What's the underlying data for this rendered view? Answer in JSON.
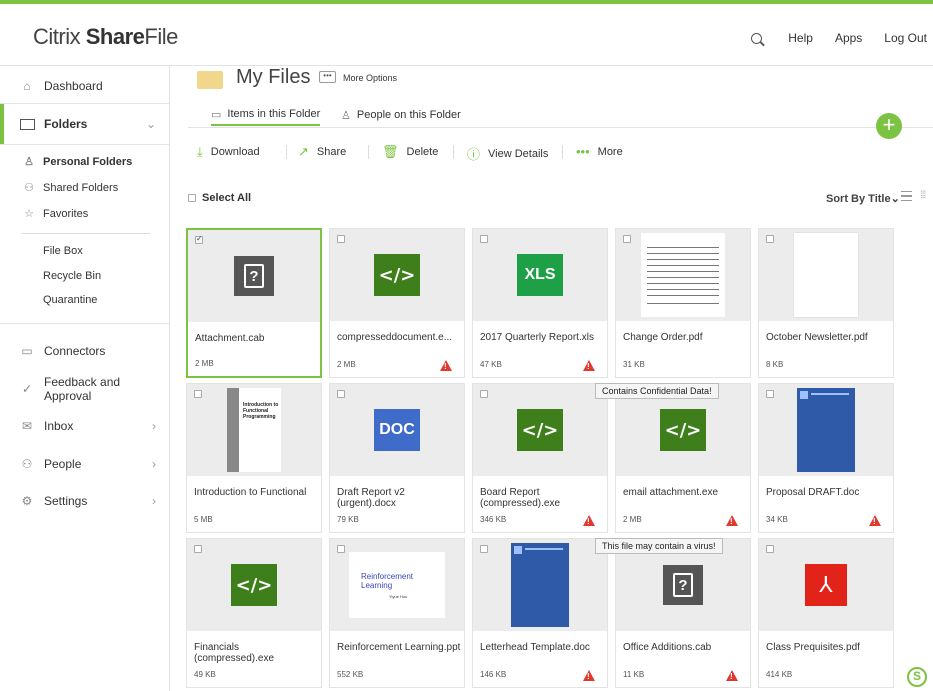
{
  "app": {
    "logo_regular": "Citrix ",
    "logo_bold": "Share",
    "logo_suffix": "File"
  },
  "topnav": {
    "help": "Help",
    "apps": "Apps",
    "logout": "Log Out"
  },
  "sidebar": {
    "dashboard": "Dashboard",
    "folders": "Folders",
    "personal_folders": "Personal Folders",
    "shared_folders": "Shared Folders",
    "favorites": "Favorites",
    "file_box": "File Box",
    "recycle_bin": "Recycle Bin",
    "quarantine": "Quarantine",
    "connectors": "Connectors",
    "feedback": "Feedback and Approval",
    "inbox": "Inbox",
    "people": "People",
    "settings": "Settings"
  },
  "header": {
    "title": "My Files",
    "more_options": "More Options",
    "tab_items": "Items in this Folder",
    "tab_people": "People on this Folder"
  },
  "actions": {
    "download": "Download",
    "share": "Share",
    "delete": "Delete",
    "view_details": "View Details",
    "more": "More"
  },
  "list": {
    "select_all": "Select All",
    "sort_by": "Sort By Title"
  },
  "files": [
    {
      "name": "Attachment.cab",
      "size": "2 MB",
      "icon": "unknown",
      "warn": false,
      "selected": true
    },
    {
      "name": "compresseddocument.e...",
      "size": "2 MB",
      "icon": "code",
      "warn": true,
      "selected": false
    },
    {
      "name": "2017 Quarterly Report.xls",
      "size": "47 KB",
      "icon": "xls",
      "warn": true,
      "selected": false
    },
    {
      "name": "Change Order.pdf",
      "size": "31 KB",
      "icon": "form-page",
      "warn": false,
      "selected": false
    },
    {
      "name": "October Newsletter.pdf",
      "size": "8 KB",
      "icon": "blank-page",
      "warn": false,
      "selected": false
    },
    {
      "name": "Introduction to Functional",
      "size": "5 MB",
      "icon": "book-page",
      "warn": false,
      "selected": false
    },
    {
      "name": "Draft Report v2 (urgent).docx",
      "size": "79 KB",
      "icon": "doc",
      "warn": false,
      "selected": false
    },
    {
      "name": "Board Report (compressed).exe",
      "size": "346 KB",
      "icon": "code",
      "warn": true,
      "selected": false
    },
    {
      "name": "email attachment.exe",
      "size": "2 MB",
      "icon": "code",
      "warn": true,
      "selected": false
    },
    {
      "name": "Proposal DRAFT.doc",
      "size": "34 KB",
      "icon": "blue-page",
      "warn": true,
      "selected": false
    },
    {
      "name": "Financials (compressed).exe",
      "size": "49 KB",
      "icon": "code",
      "warn": false,
      "selected": false
    },
    {
      "name": "Reinforcement Learning.ppt",
      "size": "552 KB",
      "icon": "slide-page",
      "warn": false,
      "selected": false
    },
    {
      "name": "Letterhead Template.doc",
      "size": "146 KB",
      "icon": "blue-page",
      "warn": true,
      "selected": false
    },
    {
      "name": "Office Additions.cab",
      "size": "11 KB",
      "icon": "unknown",
      "warn": true,
      "selected": false
    },
    {
      "name": "Class Prequisites.pdf",
      "size": "414 KB",
      "icon": "pdf",
      "warn": false,
      "selected": false
    }
  ],
  "thumb_text": {
    "code": "</>",
    "xls": "XLS",
    "doc": "DOC",
    "unknown": "?",
    "book_title": "Introduction to Functional Programming",
    "slide_title": "Reinforcement Learning",
    "slide_sub": "Yiyue Hou"
  },
  "tooltips": {
    "confidential": "Contains Confidential Data!",
    "virus": "This file may contain a virus!"
  },
  "colors": {
    "accent": "#7cc243",
    "code_icon": "#3e7f1b",
    "xls_icon": "#1ea046",
    "doc_icon": "#3f6bc9",
    "pdf_icon": "#e2231a",
    "warning": "#e03a2f"
  }
}
